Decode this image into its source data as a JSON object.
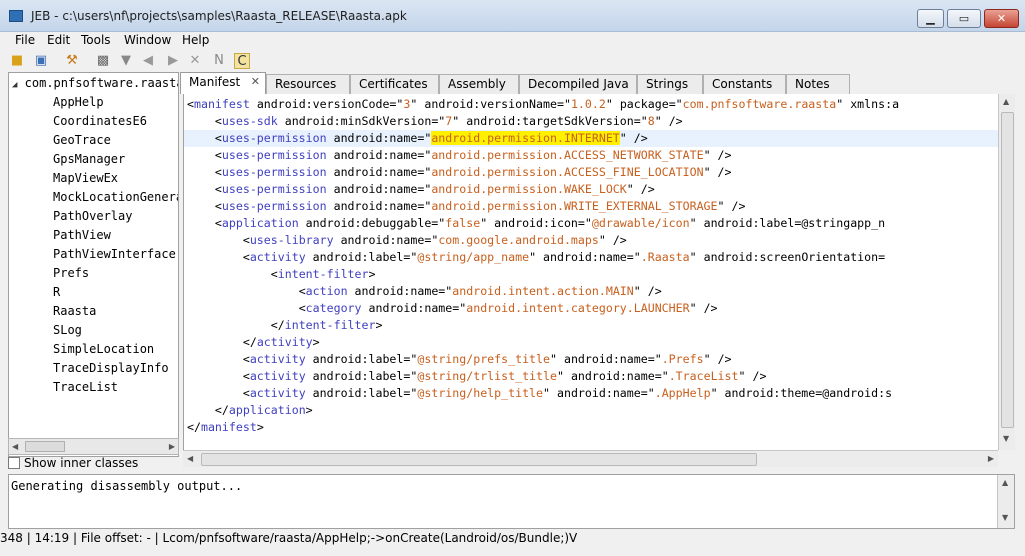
{
  "window": {
    "title": "JEB - c:\\users\\nf\\projects\\samples\\Raasta_RELEASE\\Raasta.apk",
    "minimize_label": "▁",
    "maximize_label": "▭",
    "close_label": "✕"
  },
  "menu": {
    "items": [
      {
        "label": "File"
      },
      {
        "label": "Edit"
      },
      {
        "label": "Tools"
      },
      {
        "label": "Window"
      },
      {
        "label": "Help"
      }
    ]
  },
  "toolbar": {
    "icons": [
      "folder-open-icon",
      "save-icon",
      "wrench-icon",
      "binary-icon",
      "filter-icon",
      "back-icon",
      "forward-icon",
      "delete-icon",
      "rename-icon",
      "comment-icon"
    ]
  },
  "tree": {
    "root": "com.pnfsoftware.raasta",
    "items": [
      "AppHelp",
      "CoordinatesE6",
      "GeoTrace",
      "GpsManager",
      "MapViewEx",
      "MockLocationGenerator",
      "PathOverlay",
      "PathView",
      "PathViewInterface",
      "Prefs",
      "R",
      "Raasta",
      "SLog",
      "SimpleLocation",
      "TraceDisplayInfo",
      "TraceList"
    ],
    "show_inner_classes": "Show inner classes"
  },
  "tabs": [
    {
      "label": "Manifest",
      "close": "✕"
    },
    {
      "label": "Resources"
    },
    {
      "label": "Certificates"
    },
    {
      "label": "Assembly"
    },
    {
      "label": "Decompiled Java"
    },
    {
      "label": "Strings"
    },
    {
      "label": "Constants"
    },
    {
      "label": "Notes"
    }
  ],
  "code": {
    "lines": [
      "<manifest android:versionCode=\"3\" android:versionName=\"1.0.2\" package=\"com.pnfsoftware.raasta\" xmlns:a",
      "    <uses-sdk android:minSdkVersion=\"7\" android:targetSdkVersion=\"8\" />",
      "    <uses-permission android:name=\"android.permission.INTERNET\" />",
      "    <uses-permission android:name=\"android.permission.ACCESS_NETWORK_STATE\" />",
      "    <uses-permission android:name=\"android.permission.ACCESS_FINE_LOCATION\" />",
      "    <uses-permission android:name=\"android.permission.WAKE_LOCK\" />",
      "    <uses-permission android:name=\"android.permission.WRITE_EXTERNAL_STORAGE\" />",
      "    <application android:debuggable=\"false\" android:icon=\"@drawable/icon\" android:label=\"@string/app_n",
      "        <uses-library android:name=\"com.google.android.maps\" />",
      "        <activity android:label=\"@string/app_name\" android:name=\".Raasta\" android:screenOrientation=\"",
      "            <intent-filter>",
      "                <action android:name=\"android.intent.action.MAIN\" />",
      "                <category android:name=\"android.intent.category.LAUNCHER\" />",
      "            </intent-filter>",
      "        </activity>",
      "        <activity android:label=\"@string/prefs_title\" android:name=\".Prefs\" />",
      "        <activity android:label=\"@string/trlist_title\" android:name=\".TraceList\" />",
      "        <activity android:label=\"@string/help_title\" android:name=\".AppHelp\" android:theme=\"@android:s",
      "    </application>",
      "</manifest>"
    ]
  },
  "console": {
    "text": "Generating disassembly output..."
  },
  "status": {
    "text": "348  |  14:19  |  File offset: -  |  Lcom/pnfsoftware/raasta/AppHelp;->onCreate(Landroid/os/Bundle;)V"
  }
}
